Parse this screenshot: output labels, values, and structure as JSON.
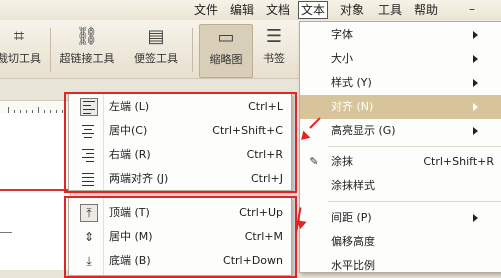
{
  "menubar": {
    "items": [
      "文件",
      "编辑",
      "文档",
      "文本",
      "对象",
      "工具",
      "帮助"
    ],
    "active": "文本",
    "minimize": "–"
  },
  "toolbar": {
    "buttons": [
      {
        "label": "裁切工具",
        "icon": "crop-icon",
        "glyph": "⌗"
      },
      {
        "label": "超链接工具",
        "icon": "link-icon",
        "glyph": "⛓"
      },
      {
        "label": "便签工具",
        "icon": "note-icon",
        "glyph": "▤"
      },
      {
        "label": "缩略图",
        "icon": "thumbnail-icon",
        "glyph": "▭"
      },
      {
        "label": "书签",
        "icon": "bookmark-list-icon",
        "glyph": "☰"
      }
    ]
  },
  "text_menu": {
    "items": [
      {
        "label": "字体",
        "submenu": true
      },
      {
        "label": "大小",
        "submenu": true
      },
      {
        "label": "样式 (Y)",
        "submenu": true
      },
      {
        "label": "对齐 (N)",
        "submenu": true,
        "highlighted": true
      },
      {
        "label": "高亮显示 (G)",
        "submenu": true
      },
      {
        "label": "涂抹",
        "shortcut": "Ctrl+Shift+R",
        "icon": "smear-icon"
      },
      {
        "label": "涂抹样式"
      },
      {
        "label": "间距 (P)",
        "submenu": true
      },
      {
        "label": "偏移高度"
      },
      {
        "label": "水平比例"
      }
    ]
  },
  "align_menu": {
    "items": [
      {
        "label": "左端 (L)",
        "shortcut": "Ctrl+L",
        "icon": "align-left-icon"
      },
      {
        "label": "居中(C)",
        "shortcut": "Ctrl+Shift+C",
        "icon": "align-center-icon"
      },
      {
        "label": "右端 (R)",
        "shortcut": "Ctrl+R",
        "icon": "align-right-icon"
      },
      {
        "label": "两端对齐 (J)",
        "shortcut": "Ctrl+J",
        "icon": "align-justify-icon"
      }
    ]
  },
  "valign_menu": {
    "items": [
      {
        "label": "顶端 (T)",
        "shortcut": "Ctrl+Up",
        "icon": "align-top-icon",
        "glyph": "⤒"
      },
      {
        "label": "居中 (M)",
        "shortcut": "Ctrl+M",
        "icon": "align-middle-icon",
        "glyph": "⇕"
      },
      {
        "label": "底端 (B)",
        "shortcut": "Ctrl+Down",
        "icon": "align-bottom-icon",
        "glyph": "⤓"
      }
    ]
  },
  "colors": {
    "highlight": "#d8c49a",
    "annotation": "#e02525"
  }
}
